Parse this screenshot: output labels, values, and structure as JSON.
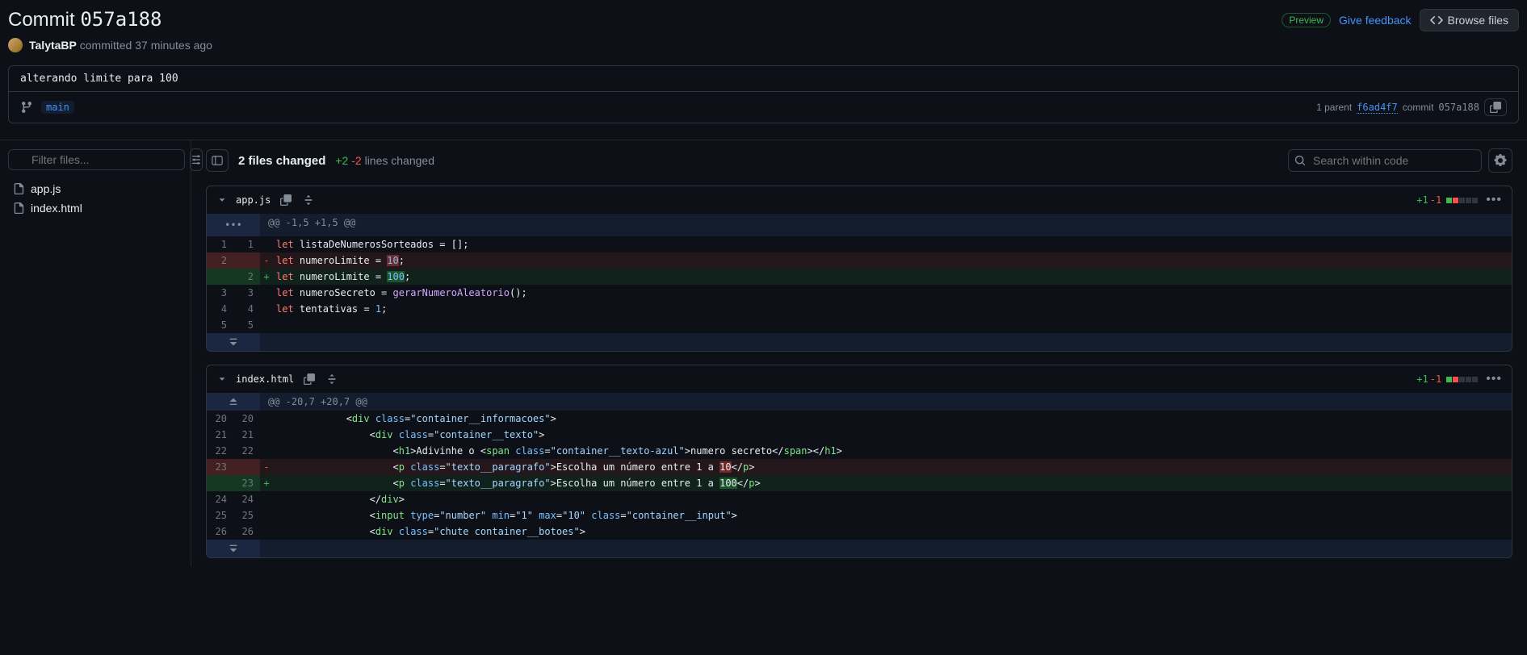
{
  "header": {
    "title_prefix": "Commit",
    "title_hash": "057a188",
    "preview_label": "Preview",
    "feedback_label": "Give feedback",
    "browse_label": "Browse files"
  },
  "author": {
    "name": "TalytaBP",
    "action": "committed",
    "time": "37 minutes ago"
  },
  "commit": {
    "message": "alterando limite para 100",
    "branch": "main",
    "parent_count": "1 parent",
    "parent_hash": "f6ad4f7",
    "commit_label": "commit",
    "commit_hash": "057a188"
  },
  "sidebar": {
    "filter_placeholder": "Filter files...",
    "files": [
      {
        "name": "app.js"
      },
      {
        "name": "index.html"
      }
    ]
  },
  "summary": {
    "files_changed": "2 files changed",
    "additions": "+2",
    "deletions": "-2",
    "lines_changed_label": "lines changed",
    "search_placeholder": "Search within code"
  },
  "diffs": [
    {
      "filename": "app.js",
      "stat_add": "+1",
      "stat_del": "-1",
      "hunk": "@@ -1,5 +1,5 @@",
      "lines": [
        {
          "t": "ctx",
          "o": "1",
          "n": "1",
          "html": "<span class='k-let'>let</span> listaDeNumerosSorteados = [];"
        },
        {
          "t": "del",
          "o": "2",
          "n": "",
          "html": "<span class='k-let'>let</span> numeroLimite = <span class='k-num hl-del'>10</span>;"
        },
        {
          "t": "add",
          "o": "",
          "n": "2",
          "html": "<span class='k-let'>let</span> numeroLimite = <span class='k-num hl-add'>100</span>;"
        },
        {
          "t": "ctx",
          "o": "3",
          "n": "3",
          "html": "<span class='k-let'>let</span> numeroSecreto = <span class='k-fn'>gerarNumeroAleatorio</span>();"
        },
        {
          "t": "ctx",
          "o": "4",
          "n": "4",
          "html": "<span class='k-let'>let</span> tentativas = <span class='k-num'>1</span>;"
        },
        {
          "t": "ctx",
          "o": "5",
          "n": "5",
          "html": ""
        }
      ]
    },
    {
      "filename": "index.html",
      "stat_add": "+1",
      "stat_del": "-1",
      "hunk": "@@ -20,7 +20,7 @@",
      "lines": [
        {
          "t": "ctx",
          "o": "20",
          "n": "20",
          "html": "            &lt;<span class='k-tag'>div</span> <span class='k-attr'>class</span>=<span class='k-str'>\"container__informacoes\"</span>&gt;"
        },
        {
          "t": "ctx",
          "o": "21",
          "n": "21",
          "html": "                &lt;<span class='k-tag'>div</span> <span class='k-attr'>class</span>=<span class='k-str'>\"container__texto\"</span>&gt;"
        },
        {
          "t": "ctx",
          "o": "22",
          "n": "22",
          "html": "                    &lt;<span class='k-tag'>h1</span>&gt;Adivinhe o &lt;<span class='k-tag'>span</span> <span class='k-attr'>class</span>=<span class='k-str'>\"container__texto-azul\"</span>&gt;numero secreto&lt;/<span class='k-tag'>span</span>&gt;&lt;/<span class='k-tag'>h1</span>&gt;"
        },
        {
          "t": "del",
          "o": "23",
          "n": "",
          "html": "                    &lt;<span class='k-tag'>p</span> <span class='k-attr'>class</span>=<span class='k-str'>\"texto__paragrafo\"</span>&gt;Escolha um número entre 1 a <span class='hl-del'>10</span>&lt;/<span class='k-tag'>p</span>&gt;"
        },
        {
          "t": "add",
          "o": "",
          "n": "23",
          "html": "                    &lt;<span class='k-tag'>p</span> <span class='k-attr'>class</span>=<span class='k-str'>\"texto__paragrafo\"</span>&gt;Escolha um número entre 1 a <span class='hl-add'>100</span>&lt;/<span class='k-tag'>p</span>&gt;"
        },
        {
          "t": "ctx",
          "o": "24",
          "n": "24",
          "html": "                &lt;/<span class='k-tag'>div</span>&gt;"
        },
        {
          "t": "ctx",
          "o": "25",
          "n": "25",
          "html": "                &lt;<span class='k-tag'>input</span> <span class='k-attr'>type</span>=<span class='k-str'>\"number\"</span> <span class='k-attr'>min</span>=<span class='k-str'>\"1\"</span> <span class='k-attr'>max</span>=<span class='k-str'>\"10\"</span> <span class='k-attr'>class</span>=<span class='k-str'>\"container__input\"</span>&gt;"
        },
        {
          "t": "ctx",
          "o": "26",
          "n": "26",
          "html": "                &lt;<span class='k-tag'>div</span> <span class='k-attr'>class</span>=<span class='k-str'>\"chute container__botoes\"</span>&gt;"
        }
      ]
    }
  ]
}
